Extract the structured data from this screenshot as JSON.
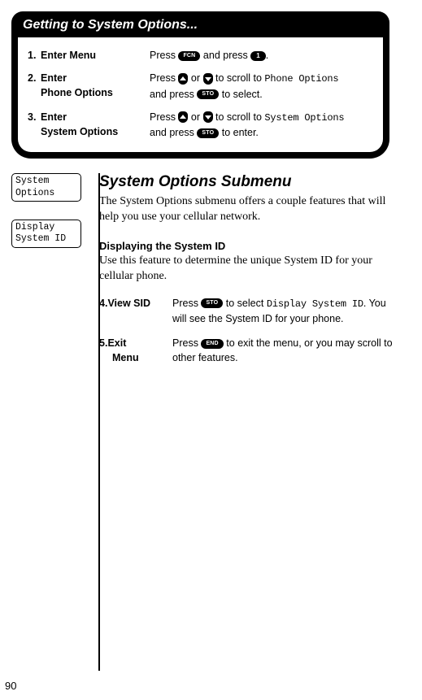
{
  "title": "Getting to System Options...",
  "steps_top": [
    {
      "num": "1.",
      "label": "Enter Menu",
      "desc_parts": [
        "Press ",
        "FCN",
        " and press ",
        "1",
        "."
      ]
    },
    {
      "num": "2.",
      "label_l1": "Enter",
      "label_l2": "Phone Options",
      "desc_l1_a": "Press ",
      "desc_l1_b": " or ",
      "desc_l1_c": " to scroll to ",
      "disp1": "Phone Options",
      "desc_l2_a": "and press ",
      "desc_l2_sto": "STO",
      "desc_l2_b": " to select."
    },
    {
      "num": "3.",
      "label_l1": "Enter",
      "label_l2": "System Options",
      "desc_l1_a": "Press ",
      "desc_l1_b": " or ",
      "desc_l1_c": " to scroll to ",
      "disp1": "System Options",
      "desc_l2_a": "and press ",
      "desc_l2_sto": "STO",
      "desc_l2_b": " to enter."
    }
  ],
  "left_boxes": [
    {
      "l1": "System",
      "l2": "Options"
    },
    {
      "l1": "Display",
      "l2": "System ID"
    }
  ],
  "section_title": "System Options Submenu",
  "intro": "The System Options submenu offers a couple features that will help you use your cellular network.",
  "subhead": "Displaying the System ID",
  "subtext": "Use this feature to determine the unique System ID for your cellular phone.",
  "sub_steps": [
    {
      "num": "4.",
      "label": "View SID",
      "a": "Press ",
      "btn": "STO",
      "b": " to select ",
      "disp": "Display System ID",
      "c": ". You will see the System ID for your phone."
    },
    {
      "num": "5.",
      "label_l1": "Exit",
      "label_l2": "Menu",
      "a": "Press ",
      "btn": "END",
      "b": " to exit the menu, or you may scroll to other features."
    }
  ],
  "page_number": "90"
}
